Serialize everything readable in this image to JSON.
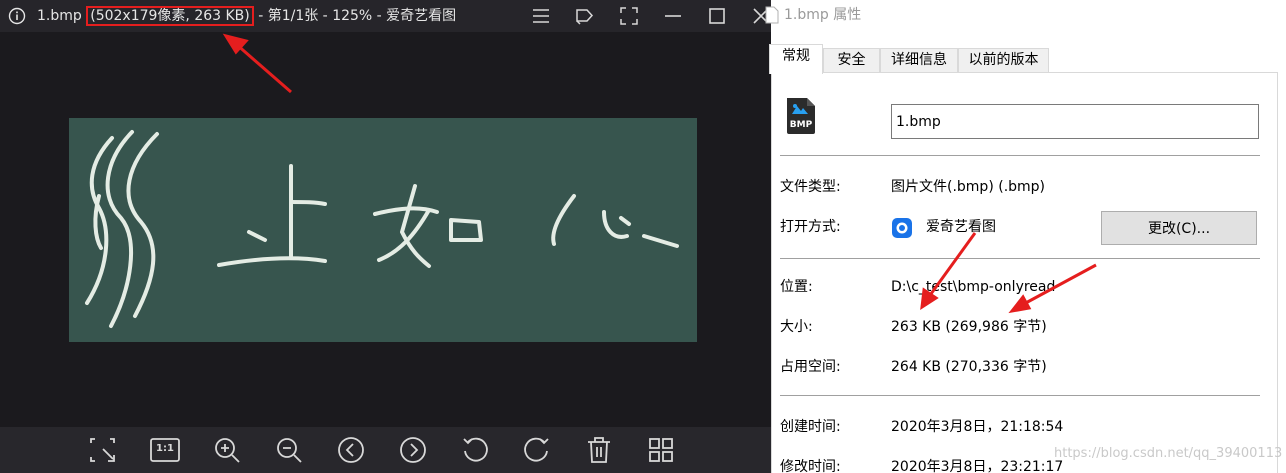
{
  "viewer": {
    "title_filename": "1.bmp",
    "title_size": "(502x179像素, 263 KB)",
    "title_rest": "- 第1/1张 - 125% - 爱奇艺看图",
    "icons": [
      "info-icon",
      "menu-icon",
      "pin-icon",
      "fullscreen-icon",
      "minimize-icon",
      "maximize-icon",
      "close-icon"
    ],
    "toolbar_icons": [
      "crop-icon",
      "actual-size-icon",
      "zoom-in-icon",
      "zoom-out-icon",
      "previous-icon",
      "next-icon",
      "rotate-left-icon",
      "rotate-right-icon",
      "delete-icon",
      "thumbnails-icon"
    ],
    "actual_size_label": "1:1"
  },
  "properties": {
    "window_title": "1.bmp 属性",
    "tabs": [
      "常规",
      "安全",
      "详细信息",
      "以前的版本"
    ],
    "file_icon_label": "BMP",
    "filename": "1.bmp",
    "file_type_label": "文件类型:",
    "file_type_value": "图片文件(.bmp) (.bmp)",
    "opens_with_label": "打开方式:",
    "opens_with_app": "爱奇艺看图",
    "change_button": "更改(C)...",
    "location_label": "位置:",
    "location_value": "D:\\c_test\\bmp-onlyread",
    "size_label": "大小:",
    "size_value": "263 KB (269,986 字节)",
    "disk_size_label": "占用空间:",
    "disk_size_value": "264 KB (270,336 字节)",
    "created_label": "创建时间:",
    "created_value": "2020年3月8日，21:18:54",
    "modified_label": "修改时间:",
    "modified_value": "2020年3月8日，23:21:17"
  },
  "watermark": "https://blog.csdn.net/qq_39400113",
  "colors": {
    "viewer_bg": "#1f1e23",
    "board": "#37554e",
    "highlight": "#e51e1e"
  }
}
